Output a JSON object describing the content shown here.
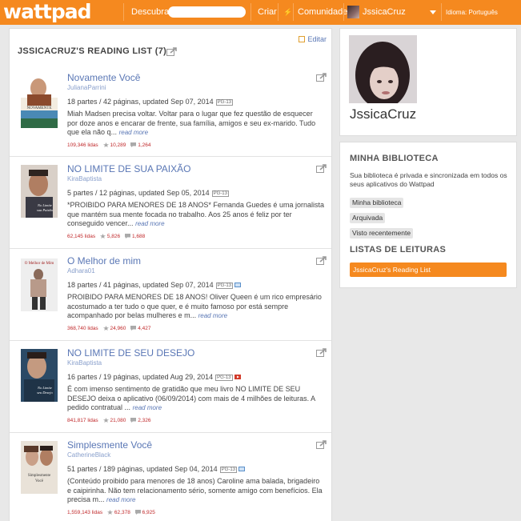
{
  "header": {
    "logo": "wattpad",
    "search_label": "Descubra",
    "search_placeholder": "",
    "create_label": "Criar",
    "community_label": "Comunidade",
    "username": "JssicaCruz",
    "language": "Idioma: Português",
    "accent_color": "#f5891f"
  },
  "main": {
    "edit_label": "Editar",
    "list_title": "JSSICACRUZ'S READING LIST (7)",
    "stories": [
      {
        "title": "Novamente Você",
        "author": "JulianaParrini",
        "meta": "18 partes / 42 páginas, updated Sep 07, 2014",
        "rating": "PG-13",
        "description": "Miah Madsen precisa voltar. Voltar para o lugar que fez questão de esquecer por doze anos e encarar de frente, sua família, amigos e seu ex-marido. Tudo que ela não q...",
        "read_more": "read more",
        "reads": "109,346",
        "reads_label": "lidas",
        "votes": "10,289",
        "comments": "1,264",
        "cover_text": "NOVAMENTE VOCÊ"
      },
      {
        "title": "NO LIMITE DE SUA PAIXÃO",
        "author": "KiraBaptista",
        "meta": "5 partes / 12 páginas, updated Sep 05, 2014",
        "rating": "PG-13",
        "description": "*PROIBIDO PARA MENORES DE 18 ANOS* Fernanda Guedes é uma jornalista que mantém sua mente focada no trabalho. Aos 25 anos é feliz por ter conseguido vencer...",
        "read_more": "read more",
        "reads": "62,145",
        "reads_label": "lidas",
        "votes": "5,826",
        "comments": "1,688",
        "cover_text": "No Limite de sua Paixão"
      },
      {
        "title": "O Melhor de mim",
        "author": "Adhara01",
        "meta": "18 partes / 41 páginas, updated Sep 07, 2014",
        "rating": "PG-13",
        "description": "PROIBIDO PARA MENORES DE 18 ANOS! Oliver Queen é um rico empresário acostumado a ter tudo o que quer, e é muito famoso por está sempre acompanhado por belas mulheres e m...",
        "read_more": "read more",
        "reads": "368,740",
        "reads_label": "lidas",
        "votes": "24,960",
        "comments": "4,427",
        "cover_text": "O Melhor de Mim"
      },
      {
        "title": "NO LIMITE DE SEU DESEJO",
        "author": "KiraBaptista",
        "meta": "16 partes / 19 páginas, updated Aug 29, 2014",
        "rating": "PG-13",
        "description": "É com imenso sentimento de gratidão que meu livro NO LIMITE DE SEU DESEJO deixa o aplicativo (06/09/2014) com mais de 4 milhões de leituras. A pedido contratual ...",
        "read_more": "read more",
        "reads": "841,817",
        "reads_label": "lidas",
        "votes": "21,080",
        "comments": "2,326",
        "cover_text": "No Limite de seu Desejo"
      },
      {
        "title": "Simplesmente Você",
        "author": "CatherineBlack",
        "meta": "51 partes / 189 páginas, updated Sep 04, 2014",
        "rating": "PG-13",
        "description": "(Conteúdo proibido para menores de 18 anos) Caroline ama balada, brigadeiro e caipirinha. Não tem relacionamento sério, somente amigo com benefícios. Ela precisa m...",
        "read_more": "read more",
        "reads": "1,559,143",
        "reads_label": "lidas",
        "votes": "62,378",
        "comments": "6,925",
        "cover_text": "Simplesmente Você"
      }
    ]
  },
  "sidebar": {
    "profile_name": "JssicaCruz",
    "library_heading": "MINHA BIBLIOTECA",
    "library_text": "Sua biblioteca é privada e sincronizada em todos os seus aplicativos do Wattpad",
    "library_buttons": [
      "Minha biblioteca",
      "Arquivada",
      "Visto recentemente"
    ],
    "reading_lists_heading": "LISTAS DE LEITURAS",
    "reading_list_item": "JssicaCruz's Reading List"
  }
}
